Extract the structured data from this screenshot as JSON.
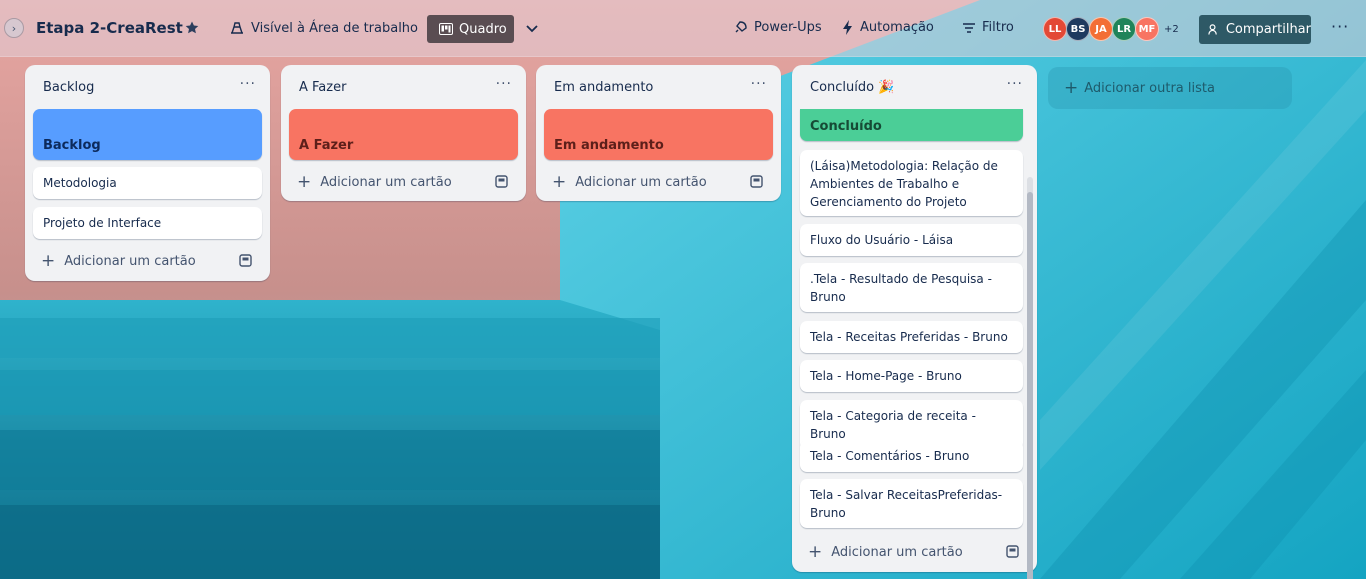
{
  "header": {
    "board_title": "Etapa 2-CreaRest",
    "visibility": "Visível à Área de trabalho",
    "view_label": "Quadro",
    "powerups": "Power-Ups",
    "automation": "Automação",
    "filter": "Filtro",
    "members": [
      {
        "initials": "LL",
        "color": "#e34935"
      },
      {
        "initials": "BS",
        "color": "#1f3a5f"
      },
      {
        "initials": "JA",
        "color": "#f36e35"
      },
      {
        "initials": "LR",
        "color": "#1f845a"
      },
      {
        "initials": "MF",
        "color": "#f87462"
      }
    ],
    "members_more": "+2",
    "share": "Compartilhar"
  },
  "lists": [
    {
      "title": "Backlog",
      "cover": {
        "label": "Backlog",
        "color": "#579dff",
        "text_color": "#0c2a5c"
      },
      "cards": [
        "Metodologia",
        "Projeto de Interface"
      ],
      "add_card": "Adicionar um cartão"
    },
    {
      "title": "A Fazer",
      "cover": {
        "label": "A Fazer",
        "color": "#f87462",
        "text_color": "#5d1f1a"
      },
      "cards": [],
      "add_card": "Adicionar um cartão"
    },
    {
      "title": "Em andamento",
      "cover": {
        "label": "Em andamento",
        "color": "#f87462",
        "text_color": "#5d1f1a"
      },
      "cards": [],
      "add_card": "Adicionar um cartão"
    },
    {
      "title": "Concluído",
      "cover": {
        "label": "Concluído",
        "color": "#4bce97",
        "text_color": "#164b35"
      },
      "cards": [
        "(Láisa)Metodologia: Relação de Ambientes de Trabalho e Gerenciamento do Projeto",
        "Fluxo do Usuário - Láisa",
        ".Tela - Resultado de Pesquisa - Bruno",
        "Tela - Receitas Preferidas - Bruno",
        "Tela - Home-Page - Bruno",
        "Tela - Categoria de receita - Bruno",
        "Tela - Comentários - Bruno",
        "Tela - Salvar ReceitasPreferidas- Bruno"
      ],
      "add_card": "Adicionar um cartão"
    }
  ],
  "add_list": "Adicionar outra lista"
}
